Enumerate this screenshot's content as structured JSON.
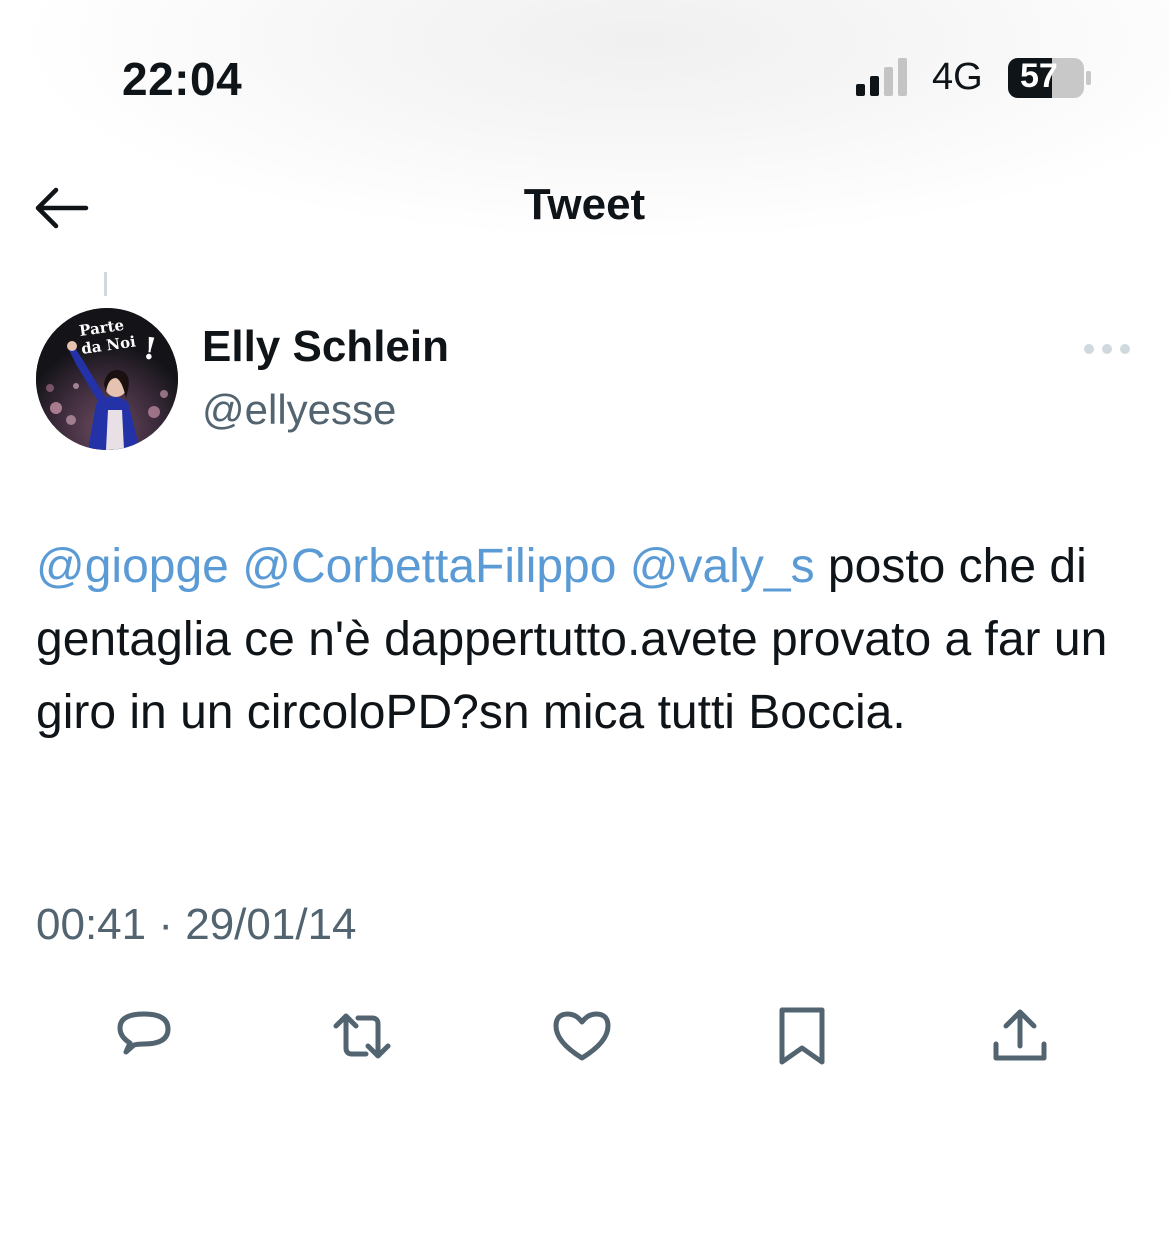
{
  "status_bar": {
    "time": "22:04",
    "network": "4G",
    "battery": "57"
  },
  "nav": {
    "title": "Tweet"
  },
  "tweet": {
    "author_name": "Elly Schlein",
    "author_handle": "@ellyesse",
    "avatar_text": "Parte da Noi!",
    "mentions": [
      "@giopge",
      "@CorbettaFilippo",
      "@valy_s"
    ],
    "text": "posto che di gentaglia ce n'è dappertutto.avete provato a far un giro in un circoloPD?sn mica tutti Boccia.",
    "time": "00:41",
    "separator": "·",
    "date": "29/01/14"
  },
  "actions": [
    {
      "name": "reply",
      "icon": "reply-icon"
    },
    {
      "name": "retweet",
      "icon": "retweet-icon"
    },
    {
      "name": "like",
      "icon": "heart-icon"
    },
    {
      "name": "bookmark",
      "icon": "bookmark-icon"
    },
    {
      "name": "share",
      "icon": "share-icon"
    }
  ],
  "colors": {
    "mention": "#5b9bd5",
    "secondary_text": "#536471",
    "icon": "#536471",
    "text": "#0f1419"
  }
}
